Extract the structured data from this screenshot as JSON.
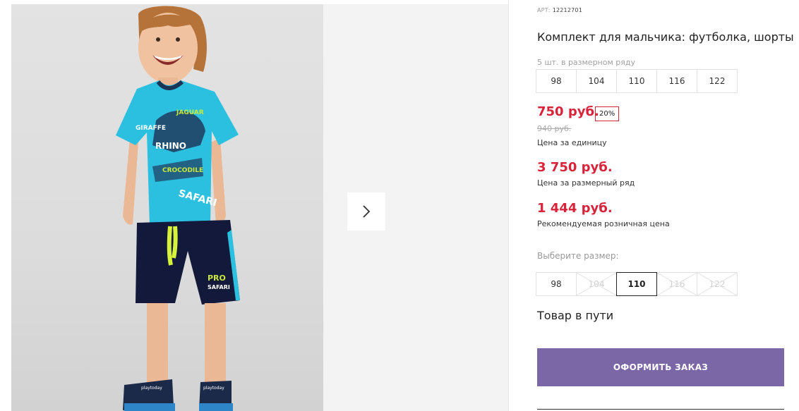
{
  "product": {
    "article_label": "АРТ:",
    "article": "12212701",
    "title": "Комплект для мальчика: футболка, шорты",
    "range_note": "5 шт. в размерном ряду",
    "range_sizes": [
      "98",
      "104",
      "110",
      "116",
      "122"
    ]
  },
  "prices": {
    "main": "750 руб.",
    "discount": "20%",
    "old": "940 руб.",
    "unit_label": "Цена за единицу",
    "range_price": "3 750 руб.",
    "range_label": "Цена за размерный ряд",
    "rrp": "1 444 руб.",
    "rrp_label": "Рекомендуемая розничная цена"
  },
  "size_select": {
    "label": "Выберите размер:",
    "options": [
      {
        "value": "98",
        "state": "available"
      },
      {
        "value": "104",
        "state": "unavailable"
      },
      {
        "value": "110",
        "state": "selected"
      },
      {
        "value": "116",
        "state": "unavailable"
      },
      {
        "value": "122",
        "state": "unavailable"
      }
    ]
  },
  "status": "Товар в пути",
  "order_button": "ОФОРМИТЬ ЗАКАЗ",
  "gallery": {
    "next_icon": "chevron-right-icon",
    "shirt_prints": [
      "JAGUAR",
      "GIRAFFE",
      "RHINO",
      "CROCODILE",
      "SAFARI"
    ],
    "shorts_print": [
      "PRO",
      "SAFARI"
    ],
    "sandal_brand": "playtoday"
  },
  "colors": {
    "price_red": "#d8243a",
    "button_purple": "#7b67a6"
  }
}
